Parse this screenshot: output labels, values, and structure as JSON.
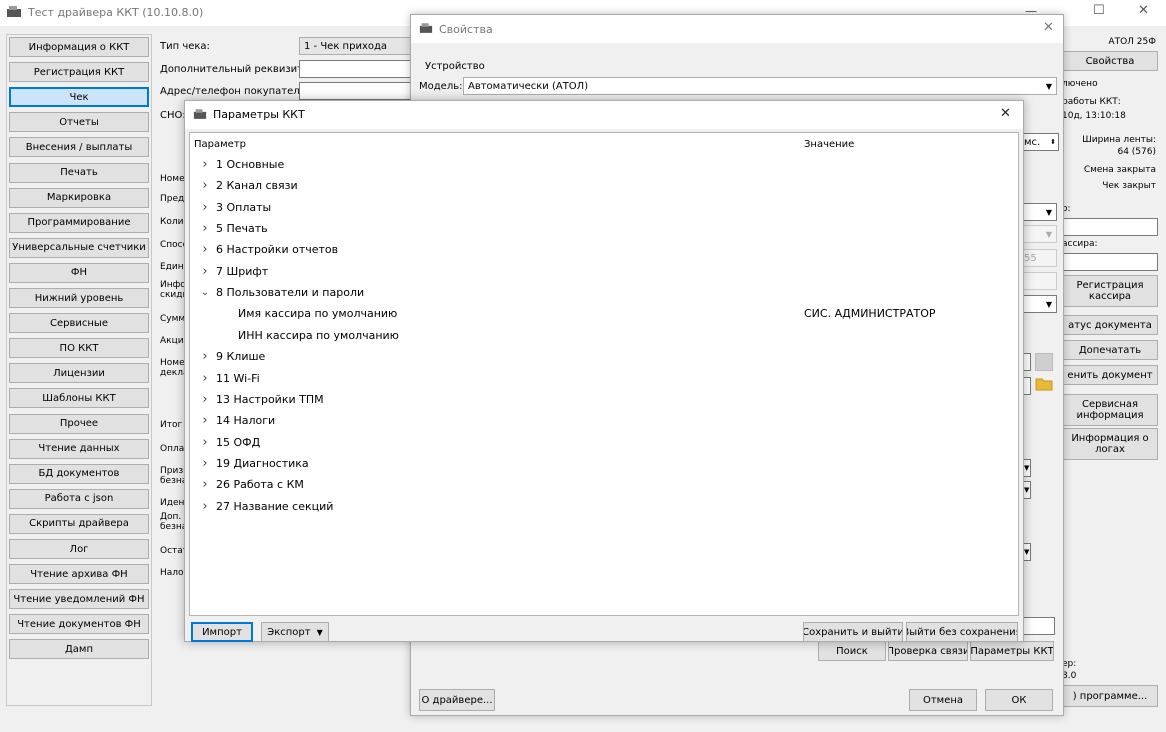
{
  "main_window": {
    "title": "Тест драйвера ККТ (10.10.8.0)",
    "controls": {
      "minimize": "—",
      "maximize": "☐",
      "close": "✕"
    },
    "sidebar": [
      {
        "label": "Информация о ККТ"
      },
      {
        "label": "Регистрация ККТ"
      },
      {
        "label": "Чек",
        "selected": true
      },
      {
        "label": "Отчеты"
      },
      {
        "label": "Внесения / выплаты"
      },
      {
        "label": "Печать"
      },
      {
        "label": "Маркировка"
      },
      {
        "label": "Программирование"
      },
      {
        "label": "Универсальные счетчики"
      },
      {
        "label": "ФН"
      },
      {
        "label": "Нижний уровень"
      },
      {
        "label": "Сервисные"
      },
      {
        "label": "ПО ККТ"
      },
      {
        "label": "Лицензии"
      },
      {
        "label": "Шаблоны ККТ"
      },
      {
        "label": "Прочее"
      },
      {
        "label": "Чтение данных"
      },
      {
        "label": "БД документов"
      },
      {
        "label": "Работа с json"
      },
      {
        "label": "Скрипты драйвера"
      },
      {
        "label": "Лог"
      },
      {
        "label": "Чтение архива ФН"
      },
      {
        "label": "Чтение уведомлений ФН"
      },
      {
        "label": "Чтение документов ФН"
      },
      {
        "label": "Дамп"
      }
    ],
    "form": {
      "check_type_label": "Тип чека:",
      "check_type_value": "1 - Чек прихода",
      "extra_req_label": "Дополнительный реквизит:",
      "buyer_addr_label": "Адрес/телефон покупателя:",
      "sno_label": "СНО:",
      "partial_labels": [
        "Номер",
        "Пред",
        "Колич",
        "Спосо",
        "Един",
        "Инфо",
        "скидк",
        "Сумм",
        "Акциз",
        "Номер",
        "декла",
        "Итог",
        "Оплат",
        "Призн",
        "безна",
        "Иден",
        "Доп.",
        "безна",
        "Остат",
        "Налог"
      ]
    },
    "right_panel": {
      "model": "АТОЛ 25Ф",
      "props_btn": "Свойства",
      "enabled": "лючено",
      "work_label": "работы ККТ:",
      "work_value": "10д, 13:10:18",
      "tape_label": "Ширина ленты:",
      "tape_value": "64 (576)",
      "shift": "Смена закрыта",
      "receipt": "Чек закрыт",
      "o_label": "о:",
      "cashier_label": "ассира:",
      "reg_cashier": "Регистрация кассира",
      "doc_status": "атус документа",
      "reprint": "Допечатать",
      "cancel_doc": "енить документ",
      "service_info": "Сервисная информация",
      "log_info": "Информация о логах",
      "ver_label": "ер:",
      "ver_value": "8.0",
      "about": ") программе..."
    }
  },
  "props_dialog": {
    "title": "Свойства",
    "device_group": "Устройство",
    "model_label": "Модель:",
    "model_value": "Автоматически (АТОЛ)",
    "ms_value": "мс.",
    "val_55": "55",
    "search_btn": "Поиск",
    "check_link_btn": "Проверка связи",
    "kkt_params_btn": "Параметры ККТ",
    "about_btn": "О драйвере...",
    "cancel_btn": "Отмена",
    "ok_btn": "ОК"
  },
  "params_dialog": {
    "title": "Параметры ККТ",
    "col_param": "Параметр",
    "col_value": "Значение",
    "rows": [
      {
        "label": "1 Основные",
        "level": 0,
        "state": "collapsed",
        "value": ""
      },
      {
        "label": "2 Канал связи",
        "level": 0,
        "state": "collapsed",
        "value": ""
      },
      {
        "label": "3 Оплаты",
        "level": 0,
        "state": "collapsed",
        "value": ""
      },
      {
        "label": "5 Печать",
        "level": 0,
        "state": "collapsed",
        "value": ""
      },
      {
        "label": "6 Настройки отчетов",
        "level": 0,
        "state": "collapsed",
        "value": ""
      },
      {
        "label": "7 Шрифт",
        "level": 0,
        "state": "collapsed",
        "value": ""
      },
      {
        "label": "8 Пользователи и пароли",
        "level": 0,
        "state": "expanded",
        "value": ""
      },
      {
        "label": "Имя кассира по умолчанию",
        "level": 1,
        "state": "leaf",
        "value": "СИС. АДМИНИСТРАТОР"
      },
      {
        "label": "ИНН кассира по умолчанию",
        "level": 1,
        "state": "leaf",
        "value": ""
      },
      {
        "label": "9 Клише",
        "level": 0,
        "state": "collapsed",
        "value": ""
      },
      {
        "label": "11 Wi-Fi",
        "level": 0,
        "state": "collapsed",
        "value": ""
      },
      {
        "label": "13 Настройки ТПМ",
        "level": 0,
        "state": "collapsed",
        "value": ""
      },
      {
        "label": "14 Налоги",
        "level": 0,
        "state": "collapsed",
        "value": ""
      },
      {
        "label": "15 ОФД",
        "level": 0,
        "state": "collapsed",
        "value": ""
      },
      {
        "label": "19 Диагностика",
        "level": 0,
        "state": "collapsed",
        "value": ""
      },
      {
        "label": "26 Работа с КМ",
        "level": 0,
        "state": "collapsed",
        "value": ""
      },
      {
        "label": "27 Название секций",
        "level": 0,
        "state": "collapsed",
        "value": ""
      }
    ],
    "import_btn": "Импорт",
    "export_btn": "Экспорт",
    "save_exit_btn": "Сохранить и выйти",
    "exit_nosave_btn": "Выйти без сохранения"
  }
}
